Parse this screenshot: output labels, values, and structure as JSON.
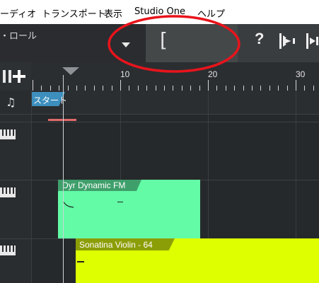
{
  "menu": {
    "items": [
      {
        "label": "ーディオ"
      },
      {
        "label": "トランスポート"
      },
      {
        "label": "表示"
      },
      {
        "label": "Studio One"
      },
      {
        "label": "ヘルプ"
      }
    ]
  },
  "toolbar": {
    "view_label": "・ロール",
    "dropdown_icon": "chevron-down-icon",
    "bracket_text": "[",
    "help_label": "?",
    "icons": [
      "help-icon",
      "loop-icon",
      "snap-icon"
    ]
  },
  "ruler": {
    "bar_numbers": [
      "10",
      "20",
      "30"
    ]
  },
  "markers": {
    "start_label": "スタート"
  },
  "clips": [
    {
      "name": "Dyr Dynamic FM",
      "color": "#63fba6"
    },
    {
      "name": "Sonatina Violin - 64",
      "color": "#ddff00"
    }
  ],
  "annotation": {
    "color": "#e8141c"
  }
}
